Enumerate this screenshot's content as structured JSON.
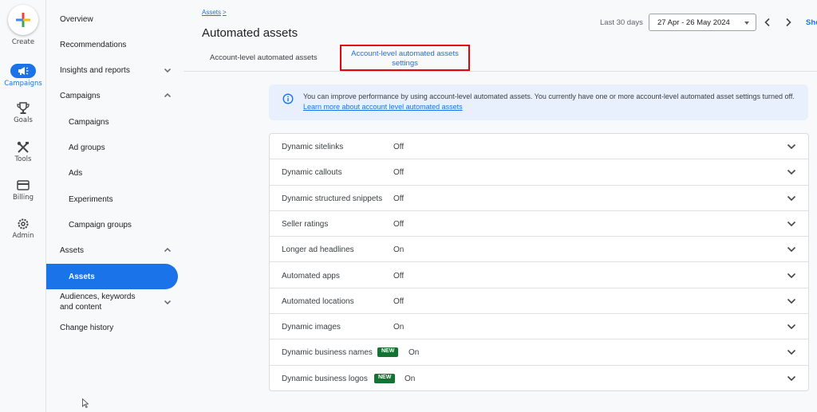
{
  "rail": {
    "create": "Create",
    "campaigns": "Campaigns",
    "goals": "Goals",
    "tools": "Tools",
    "billing": "Billing",
    "admin": "Admin"
  },
  "nav": {
    "overview": "Overview",
    "recommendations": "Recommendations",
    "insights": "Insights and reports",
    "campaigns": "Campaigns",
    "campaigns_sub": "Campaigns",
    "ad_groups": "Ad groups",
    "ads": "Ads",
    "experiments": "Experiments",
    "campaign_groups": "Campaign groups",
    "assets": "Assets",
    "assets_sub": "Assets",
    "audiences": "Audiences, keywords and content",
    "change_history": "Change history"
  },
  "header": {
    "breadcrumb": "Assets",
    "breadcrumb_sep": ">",
    "title": "Automated assets",
    "date_label": "Last 30 days",
    "date_range": "27 Apr - 26 May 2024",
    "show_link": "Sho"
  },
  "tabs": {
    "account_level": "Account-level automated assets",
    "settings_line1": "Account-level automated assets",
    "settings_line2": "settings"
  },
  "info": {
    "text": "You can improve performance by using account-level automated assets. You currently have one or more account-level automated asset settings turned off.",
    "link": "Learn more about account level automated assets"
  },
  "settings": [
    {
      "name": "Dynamic sitelinks",
      "status": "Off",
      "badge": ""
    },
    {
      "name": "Dynamic callouts",
      "status": "Off",
      "badge": ""
    },
    {
      "name": "Dynamic structured snippets",
      "status": "Off",
      "badge": ""
    },
    {
      "name": "Seller ratings",
      "status": "Off",
      "badge": ""
    },
    {
      "name": "Longer ad headlines",
      "status": "On",
      "badge": ""
    },
    {
      "name": "Automated apps",
      "status": "Off",
      "badge": ""
    },
    {
      "name": "Automated locations",
      "status": "Off",
      "badge": ""
    },
    {
      "name": "Dynamic images",
      "status": "On",
      "badge": ""
    },
    {
      "name": "Dynamic business names",
      "status": "On",
      "badge": "NEW"
    },
    {
      "name": "Dynamic business logos",
      "status": "On",
      "badge": "NEW"
    }
  ],
  "icons": {
    "create": "plus-icon",
    "campaigns": "megaphone-icon",
    "goals": "trophy-icon",
    "tools": "tools-icon",
    "billing": "credit-card-icon",
    "admin": "gear-icon",
    "info": "info-icon",
    "expand": "chevron-down-icon"
  },
  "colors": {
    "accent": "#1a73e8",
    "highlight_box": "#e8000b",
    "new_badge": "#137333",
    "info_bg": "#e8f0fe"
  }
}
